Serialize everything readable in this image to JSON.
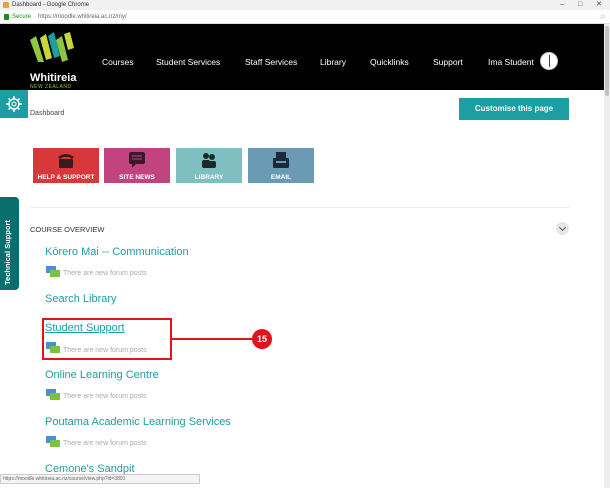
{
  "browser": {
    "window_title": "Dashboard - Google Chrome",
    "secure_label": "Secure",
    "url": "https://moodle.whitireia.ac.nz/my/",
    "window_controls": "– □ ✕"
  },
  "header": {
    "logo_name": "Whitireia",
    "logo_sub": "NEW ZEALAND",
    "nav": [
      "Courses",
      "Student Services",
      "Staff Services",
      "Library",
      "Quicklinks",
      "Support"
    ],
    "user_name": "Ima Student"
  },
  "page": {
    "breadcrumb": "Dashboard",
    "customise_label": "Customise this page",
    "side_tab_label": "Technical Support"
  },
  "tiles": [
    {
      "label": "HELP & SUPPORT",
      "color": "#d8383a",
      "icon": "phone-icon"
    },
    {
      "label": "SITE NEWS",
      "color": "#c2447f",
      "icon": "chat-icon"
    },
    {
      "label": "LIBRARY",
      "color": "#7fbfc2",
      "icon": "people-icon"
    },
    {
      "label": "EMAIL",
      "color": "#6b9ab4",
      "icon": "fax-icon"
    }
  ],
  "overview": {
    "title": "COURSE OVERVIEW",
    "courses": [
      {
        "name": "Kōrero Mai -- Communication",
        "note": "There are new forum posts"
      },
      {
        "name": "Search Library",
        "note": ""
      },
      {
        "name": "Student Support",
        "note": "There are new forum posts"
      },
      {
        "name": "Online Learning Centre",
        "note": "There are new forum posts"
      },
      {
        "name": "Poutama Academic Learning Services",
        "note": "There are new forum posts"
      },
      {
        "name": "Cemone's Sandpit",
        "note": ""
      }
    ]
  },
  "annotation": {
    "number": "15",
    "color": "#e3121b"
  },
  "statusbar": {
    "text": "https://moodle.whitireia.ac.nz/course/view.php?id=3891"
  },
  "colors": {
    "accent": "#1c9ea3",
    "nav_bg": "#000000",
    "logo_green": "#8dc63f"
  }
}
